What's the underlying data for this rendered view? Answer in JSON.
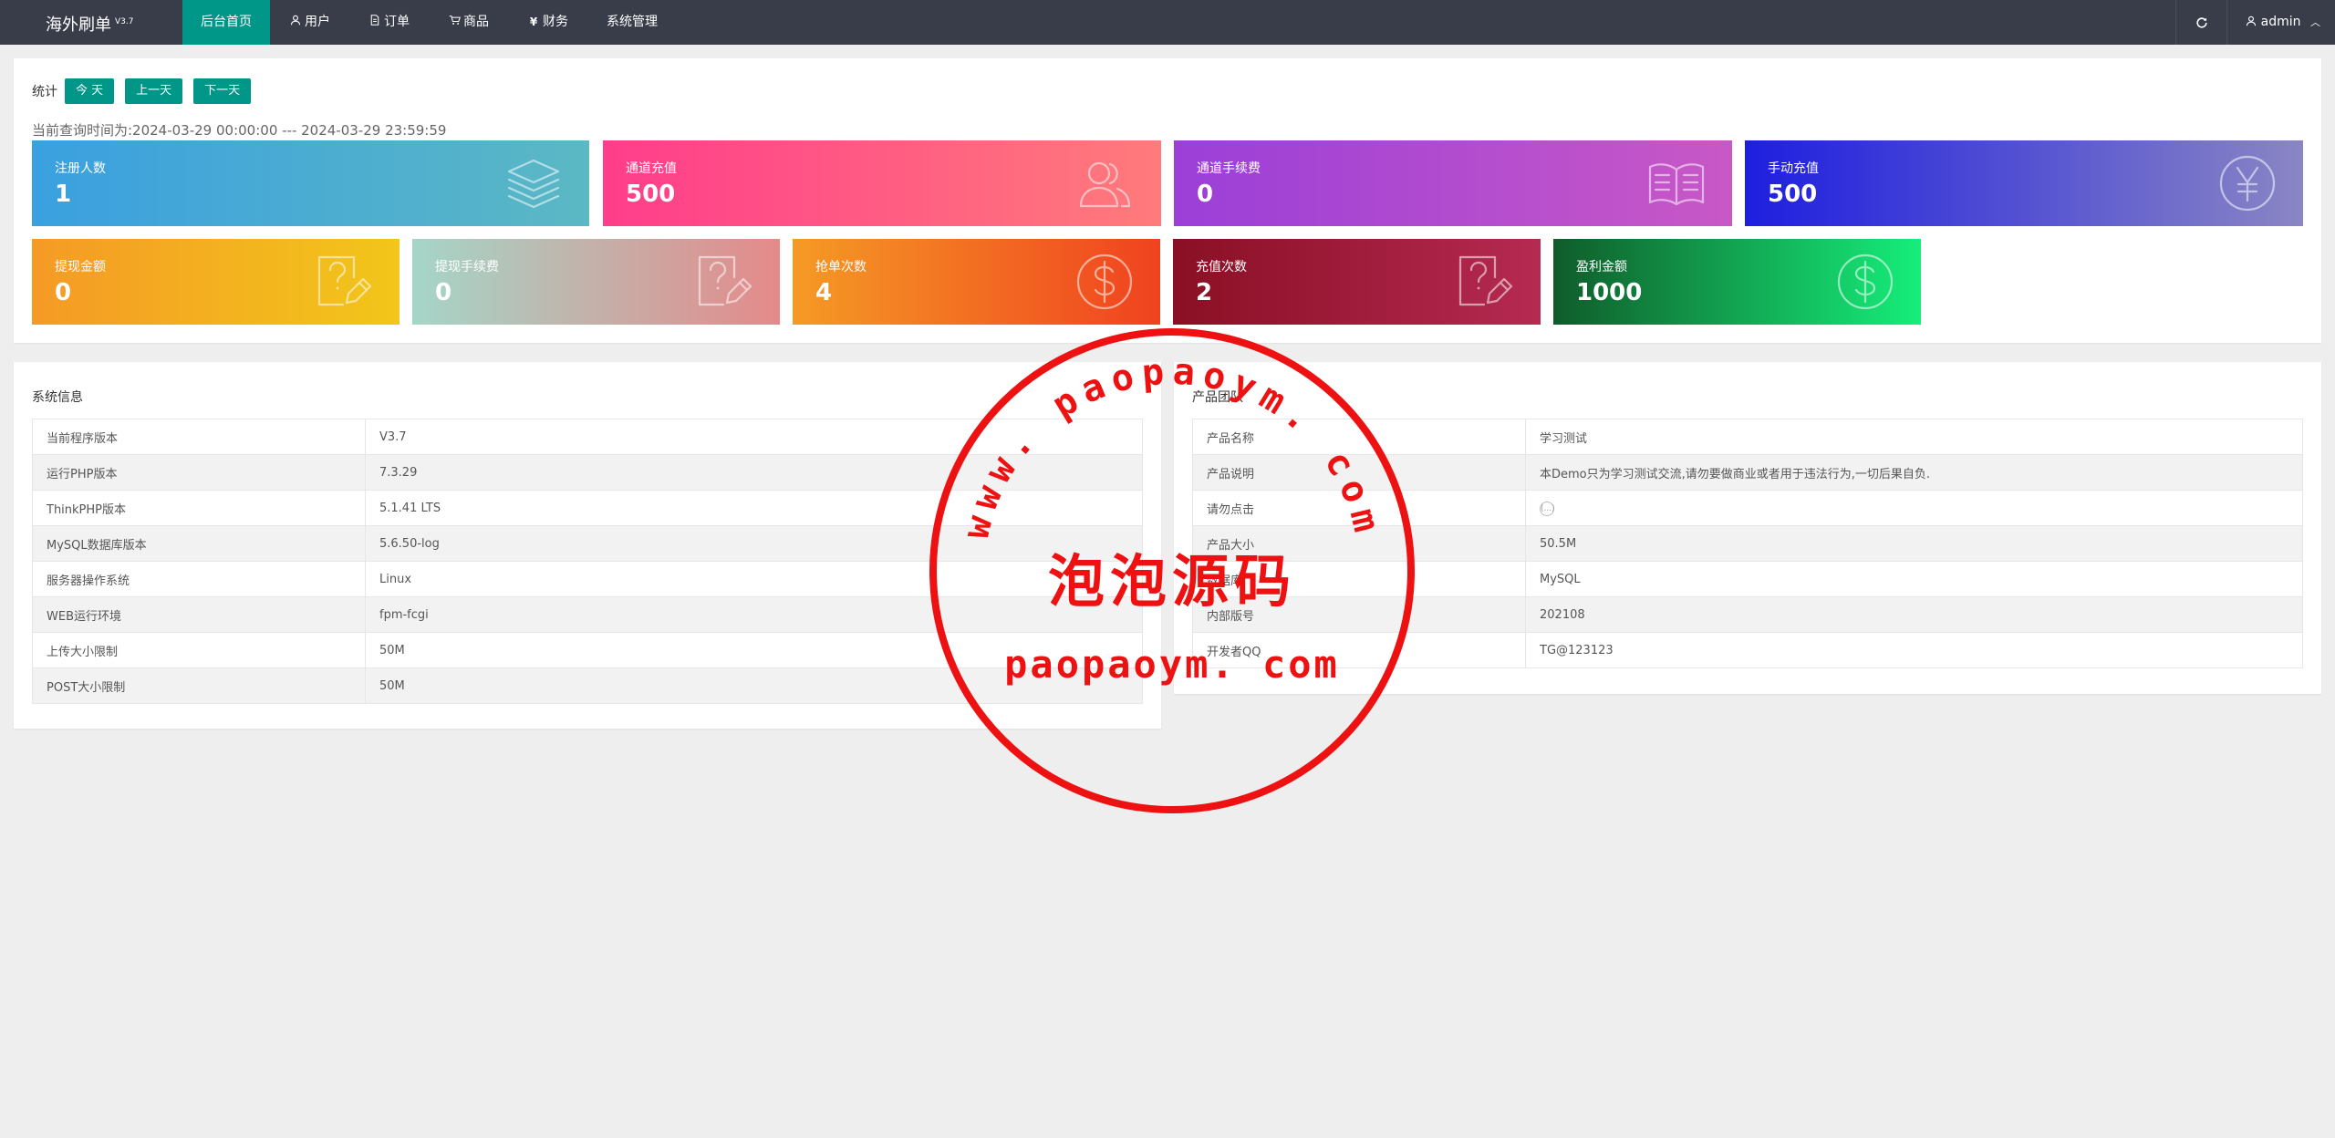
{
  "header": {
    "app_title": "海外刷单",
    "app_version": "V3.7",
    "nav": [
      {
        "label": "后台首页",
        "icon": "",
        "active": true
      },
      {
        "label": "用户",
        "icon": "user-icon"
      },
      {
        "label": "订单",
        "icon": "document-icon"
      },
      {
        "label": "商品",
        "icon": "cart-icon"
      },
      {
        "label": "财务",
        "icon": "yen-icon"
      },
      {
        "label": "系统管理",
        "icon": ""
      }
    ],
    "refresh_icon": "refresh-icon",
    "user_name": "admin"
  },
  "stats": {
    "filter_label": "统计",
    "buttons": [
      "今 天",
      "上一天",
      "下一天"
    ],
    "range_text": "当前查询时间为:2024-03-29 00:00:00 --- 2024-03-29 23:59:59",
    "tiles": [
      {
        "label": "注册人数",
        "value": "1",
        "icon": "layers-icon",
        "colors": [
          "#3aa0e0",
          "#5bb8c4"
        ]
      },
      {
        "label": "通道充值",
        "value": "500",
        "icon": "users-icon",
        "colors": [
          "#ff3d8b",
          "#ff7b7b"
        ]
      },
      {
        "label": "通道手续费",
        "value": "0",
        "icon": "book-icon",
        "colors": [
          "#9b3fd8",
          "#c858c6"
        ]
      },
      {
        "label": "手动充值",
        "value": "500",
        "icon": "yen-circle-icon",
        "colors": [
          "#1e1ee0",
          "#8a86c4"
        ]
      },
      {
        "label": "提现金额",
        "value": "0",
        "icon": "question-edit-icon",
        "colors": [
          "#f59a25",
          "#f2c61a"
        ]
      },
      {
        "label": "提现手续费",
        "value": "0",
        "icon": "question-edit-icon",
        "colors": [
          "#a4d6c8",
          "#e48a8a"
        ]
      },
      {
        "label": "抢单次数",
        "value": "4",
        "icon": "dollar-circle-icon",
        "colors": [
          "#f59a25",
          "#f0421f"
        ]
      },
      {
        "label": "充值次数",
        "value": "2",
        "icon": "question-edit-icon",
        "colors": [
          "#8a0f24",
          "#b52a52"
        ]
      },
      {
        "label": "盈利金额",
        "value": "1000",
        "icon": "dollar-circle-icon",
        "colors": [
          "#0f5c2a",
          "#16ee7a"
        ]
      }
    ]
  },
  "system_info": {
    "title": "系统信息",
    "rows": [
      {
        "key": "当前程序版本",
        "value": "V3.7"
      },
      {
        "key": "运行PHP版本",
        "value": "7.3.29"
      },
      {
        "key": "ThinkPHP版本",
        "value": "5.1.41 LTS"
      },
      {
        "key": "MySQL数据库版本",
        "value": "5.6.50-log"
      },
      {
        "key": "服务器操作系统",
        "value": "Linux"
      },
      {
        "key": "WEB运行环境",
        "value": "fpm-fcgi"
      },
      {
        "key": "上传大小限制",
        "value": "50M"
      },
      {
        "key": "POST大小限制",
        "value": "50M"
      }
    ]
  },
  "product_team": {
    "title": "产品团队",
    "rows": [
      {
        "key": "产品名称",
        "value": "学习测试"
      },
      {
        "key": "产品说明",
        "value": "本Demo只为学习测试交流,请勿要做商业或者用于违法行为,一切后果自负."
      },
      {
        "key": "请勿点击",
        "value": "(...)"
      },
      {
        "key": "产品大小",
        "value": "50.5M"
      },
      {
        "key": "数据库",
        "value": "MySQL"
      },
      {
        "key": "内部版号",
        "value": "202108"
      },
      {
        "key": "开发者QQ",
        "value": "TG@123123"
      }
    ]
  },
  "watermark": {
    "arc_text": "www. paopaoym. com",
    "center_text": "泡泡源码",
    "bottom_text": "paopaoym. com",
    "color": "#ee1111"
  }
}
